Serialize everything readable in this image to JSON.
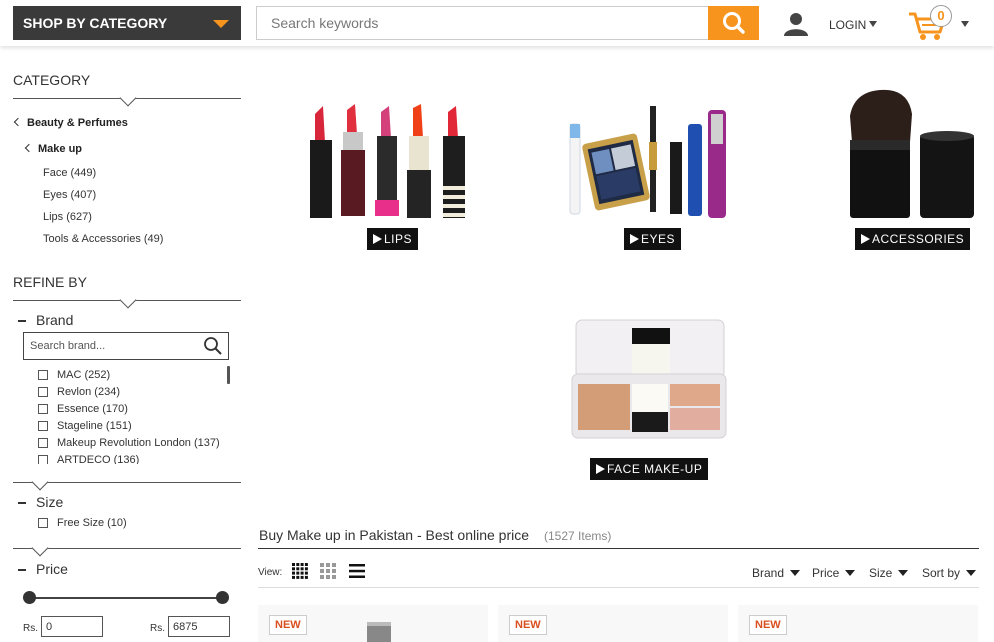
{
  "header": {
    "shop_by_category": "SHOP BY CATEGORY",
    "search_placeholder": "Search keywords",
    "login": "LOGIN",
    "cart_count": "0",
    "accent_color": "#f7941d"
  },
  "sidebar": {
    "category_title": "CATEGORY",
    "crumbs": [
      {
        "label": "Beauty & Perfumes"
      },
      {
        "label": "Make up"
      }
    ],
    "subcategories": [
      {
        "label": "Face (449)"
      },
      {
        "label": "Eyes (407)"
      },
      {
        "label": "Lips (627)"
      },
      {
        "label": "Tools & Accessories (49)"
      }
    ],
    "refine_title": "REFINE BY",
    "brand": {
      "title": "Brand",
      "search_placeholder": "Search brand...",
      "items": [
        {
          "label": "MAC (252)"
        },
        {
          "label": "Revlon (234)"
        },
        {
          "label": "Essence (170)"
        },
        {
          "label": "Stageline (151)"
        },
        {
          "label": "Makeup Revolution London (137)"
        },
        {
          "label": "ARTDECO (136)"
        }
      ]
    },
    "size": {
      "title": "Size",
      "items": [
        {
          "label": "Free Size (10)"
        }
      ]
    },
    "price": {
      "title": "Price",
      "currency_label": "Rs.",
      "min_value": "0",
      "max_value": "6875"
    }
  },
  "categories": [
    {
      "label": "LIPS",
      "icon": "lipsticks-image"
    },
    {
      "label": "EYES",
      "icon": "eye-makeup-image"
    },
    {
      "label": "ACCESSORIES",
      "icon": "brush-image"
    },
    {
      "label": "FACE MAKE-UP",
      "icon": "face-palette-image"
    }
  ],
  "listing": {
    "title": "Buy Make up in Pakistan - Best online price",
    "count": "(1527 Items)",
    "view_label": "View:",
    "filters": [
      {
        "label": "Brand"
      },
      {
        "label": "Price"
      },
      {
        "label": "Size"
      },
      {
        "label": "Sort by"
      }
    ],
    "badges": [
      {
        "label": "NEW"
      },
      {
        "label": "NEW"
      },
      {
        "label": "NEW"
      }
    ]
  }
}
